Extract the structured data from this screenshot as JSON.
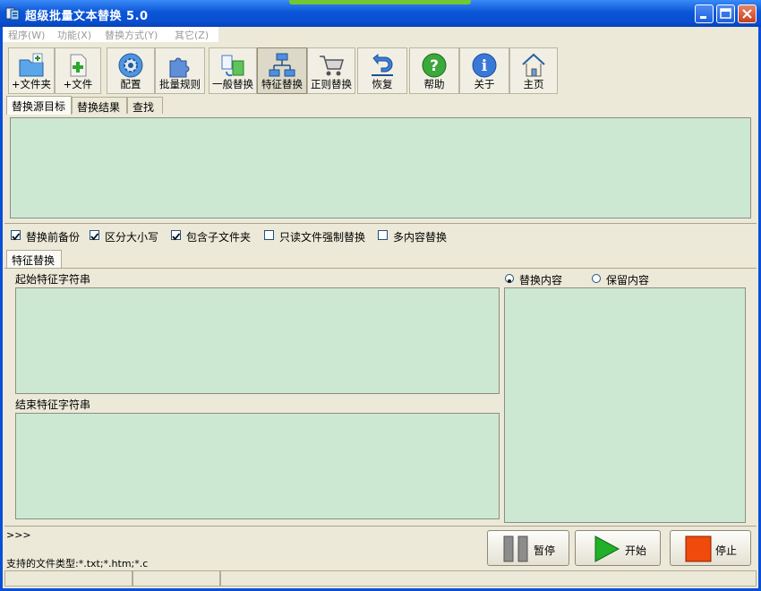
{
  "window": {
    "title": "超级批量文本替换 5.0"
  },
  "menu": [
    {
      "label": "程序(W)"
    },
    {
      "label": "功能(X)"
    },
    {
      "label": "替换方式(Y)"
    },
    {
      "label": "其它(Z)"
    }
  ],
  "toolbar": [
    {
      "label": "+文件夹",
      "icon": "add-folder-icon"
    },
    {
      "label": "+文件",
      "icon": "add-file-icon"
    },
    {
      "label": "配置",
      "icon": "config-gear-icon"
    },
    {
      "label": "批量规则",
      "icon": "puzzle-icon"
    },
    {
      "label": "一般替换",
      "icon": "general-replace-icon"
    },
    {
      "label": "特征替换",
      "icon": "feature-replace-icon",
      "pressed": true
    },
    {
      "label": "正则替换",
      "icon": "cart-icon"
    },
    {
      "label": "恢复",
      "icon": "restore-arrow-icon"
    },
    {
      "label": "帮助",
      "icon": "help-icon"
    },
    {
      "label": "关于",
      "icon": "info-icon"
    },
    {
      "label": "主页",
      "icon": "home-icon"
    }
  ],
  "tabs": [
    {
      "label": "替换源目标",
      "active": true
    },
    {
      "label": "替换结果"
    },
    {
      "label": "查找"
    }
  ],
  "options": [
    {
      "label": "替换前备份",
      "checked": true
    },
    {
      "label": "区分大小写",
      "checked": true
    },
    {
      "label": "包含子文件夹",
      "checked": true
    },
    {
      "label": "只读文件强制替换",
      "checked": false
    },
    {
      "label": "多内容替换",
      "checked": false
    }
  ],
  "feature": {
    "tab_label": "特征替换",
    "start_label": "起始特征字符串",
    "end_label": "结束特征字符串",
    "replace_radio": "替换内容",
    "keep_radio": "保留内容",
    "selected": "replace"
  },
  "log": {
    "prompt": ">>>",
    "file_types": "支持的文件类型:*.txt;*.htm;*.c"
  },
  "actions": {
    "pause": "暂停",
    "start": "开始",
    "stop": "停止"
  },
  "colors": {
    "title_bar": "#0b56d8",
    "panel_green": "#cde8d2",
    "start_green": "#22b02a",
    "stop_orange": "#f04a0c"
  }
}
